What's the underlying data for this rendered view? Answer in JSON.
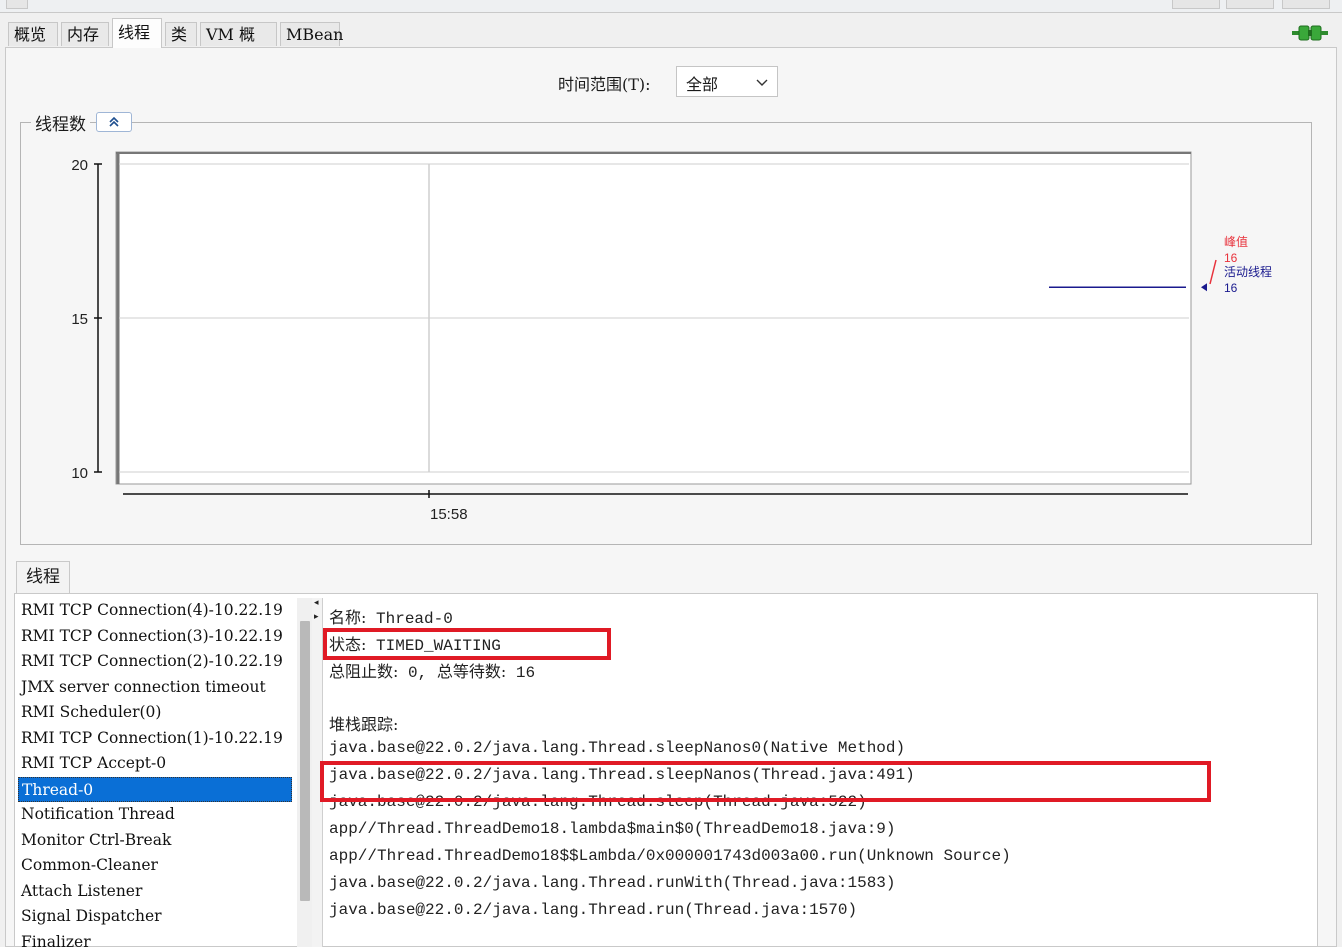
{
  "tabs": [
    {
      "label": "概览"
    },
    {
      "label": "内存"
    },
    {
      "label": "线程",
      "active": true
    },
    {
      "label": "类"
    },
    {
      "label": "VM 概要"
    },
    {
      "label": "MBean"
    }
  ],
  "time_range": {
    "label": "时间范围(T):",
    "value": "全部"
  },
  "threads_panel": {
    "title": "线程数"
  },
  "chart_data": {
    "type": "line",
    "yticks": [
      "20",
      "15",
      "10"
    ],
    "ylim": [
      10,
      20
    ],
    "xticks": [
      "15:58"
    ],
    "series": [
      {
        "name": "峰值",
        "color": "#e8323c",
        "values": [
          16
        ]
      },
      {
        "name": "活动线程",
        "color": "#1a1a8e",
        "values": [
          16
        ]
      }
    ],
    "legend": {
      "peak_label": "峰值",
      "peak_value": "16",
      "live_label": "活动线程",
      "live_value": "16"
    }
  },
  "lower_tab": {
    "label": "线程"
  },
  "thread_list": [
    "RMI TCP Connection(4)-10.22.19",
    "RMI TCP Connection(3)-10.22.19",
    "RMI TCP Connection(2)-10.22.19",
    "JMX server connection timeout",
    "RMI Scheduler(0)",
    "RMI TCP Connection(1)-10.22.19",
    "RMI TCP Accept-0",
    "Thread-0",
    "Notification Thread",
    "Monitor Ctrl-Break",
    "Common-Cleaner",
    "Attach Listener",
    "Signal Dispatcher",
    "Finalizer"
  ],
  "selected_thread": "Thread-0",
  "details": {
    "name_label": "名称:",
    "name_value": "Thread-0",
    "state_label": "状态:",
    "state_value": "TIMED_WAITING",
    "blocked_label": "总阻止数:",
    "blocked_value": "0,",
    "waited_label": "总等待数:",
    "waited_value": "16",
    "stack_label": "堆栈跟踪:",
    "stack": [
      "java.base@22.0.2/java.lang.Thread.sleepNanos0(Native Method)",
      "java.base@22.0.2/java.lang.Thread.sleepNanos(Thread.java:491)",
      "java.base@22.0.2/java.lang.Thread.sleep(Thread.java:522)",
      "app//Thread.ThreadDemo18.lambda$main$0(ThreadDemo18.java:9)",
      "app//Thread.ThreadDemo18$$Lambda/0x000001743d003a00.run(Unknown Source)",
      "java.base@22.0.2/java.lang.Thread.runWith(Thread.java:1583)",
      "java.base@22.0.2/java.lang.Thread.run(Thread.java:1570)"
    ]
  }
}
